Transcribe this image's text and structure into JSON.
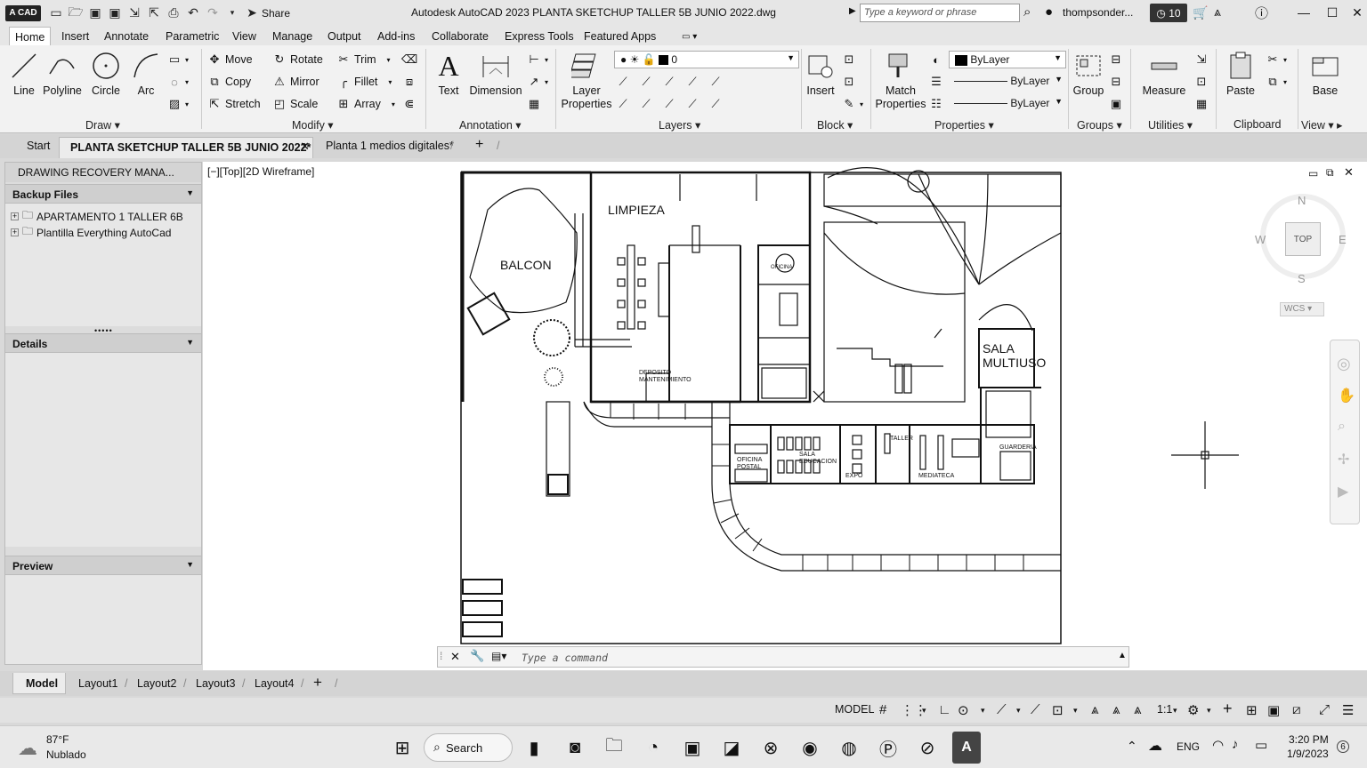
{
  "titlebar": {
    "app_logo": "A CAD",
    "share": "Share",
    "title": "Autodesk AutoCAD 2023   PLANTA SKETCHUP TALLER 5B JUNIO 2022.dwg",
    "search_placeholder": "Type a keyword or phrase",
    "user": "thompsonder...",
    "clock_count": "10"
  },
  "ribbon_tabs": [
    "Home",
    "Insert",
    "Annotate",
    "Parametric",
    "View",
    "Manage",
    "Output",
    "Add-ins",
    "Collaborate",
    "Express Tools",
    "Featured Apps"
  ],
  "ribbon": {
    "draw": {
      "title": "Draw",
      "line": "Line",
      "polyline": "Polyline",
      "circle": "Circle",
      "arc": "Arc"
    },
    "modify": {
      "title": "Modify",
      "move": "Move",
      "rotate": "Rotate",
      "trim": "Trim",
      "copy": "Copy",
      "mirror": "Mirror",
      "fillet": "Fillet",
      "stretch": "Stretch",
      "scale": "Scale",
      "array": "Array"
    },
    "annotation": {
      "title": "Annotation",
      "text": "Text",
      "dimension": "Dimension"
    },
    "layers": {
      "title": "Layers",
      "layer_properties": "Layer Properties",
      "current_layer": "0"
    },
    "block": {
      "title": "Block",
      "insert": "Insert"
    },
    "properties": {
      "title": "Properties",
      "match_properties": "Match Properties",
      "color": "ByLayer",
      "linetype": "ByLayer",
      "lineweight": "ByLayer"
    },
    "groups": {
      "title": "Groups",
      "group": "Group"
    },
    "utilities": {
      "title": "Utilities",
      "measure": "Measure"
    },
    "clipboard": {
      "title": "Clipboard",
      "paste": "Paste"
    },
    "view": {
      "title": "View",
      "base": "Base"
    }
  },
  "doc_tabs": {
    "start": "Start",
    "active": "PLANTA SKETCHUP TALLER 5B JUNIO 2022*",
    "other": "Planta 1 medios digitales*"
  },
  "palette": {
    "title": "DRAWING RECOVERY MANA...",
    "backup_files": "Backup Files",
    "files": [
      "APARTAMENTO 1 TALLER 6B",
      "Plantilla Everything AutoCad"
    ],
    "details": "Details",
    "preview": "Preview"
  },
  "viewport": {
    "label": "[−][Top][2D Wireframe]",
    "rooms": {
      "balcon": "BALCON",
      "limpieza": "LIMPIEZA",
      "sala_multiuso_1": "SALA",
      "sala_multiuso_2": "MULTIUSO",
      "deposito_1": "DEPOSITO",
      "deposito_2": "MANTENIMIENTO",
      "oficina_postal_1": "OFICINA",
      "oficina_postal_2": "POSTAL",
      "sala_educacion_1": "SALA",
      "sala_educacion_2": "EDUCACION",
      "expo": "EXPO",
      "taller": "TALLER",
      "mediateca": "MEDIATECA",
      "guarderia": "GUARDERIA",
      "oficina": "OFICINA"
    },
    "viewcube": {
      "north": "N",
      "south": "S",
      "east": "E",
      "west": "W",
      "top": "TOP",
      "wcs": "WCS"
    }
  },
  "command": {
    "placeholder": "Type a command"
  },
  "layout_tabs": [
    "Model",
    "Layout1",
    "Layout2",
    "Layout3",
    "Layout4"
  ],
  "statusbar": {
    "model": "MODEL",
    "scale": "1:1"
  },
  "taskbar": {
    "weather_temp": "87°F",
    "weather_desc": "Nublado",
    "search": "Search",
    "lang": "ENG",
    "time": "3:20 PM",
    "date": "1/9/2023",
    "notifications": "6"
  }
}
